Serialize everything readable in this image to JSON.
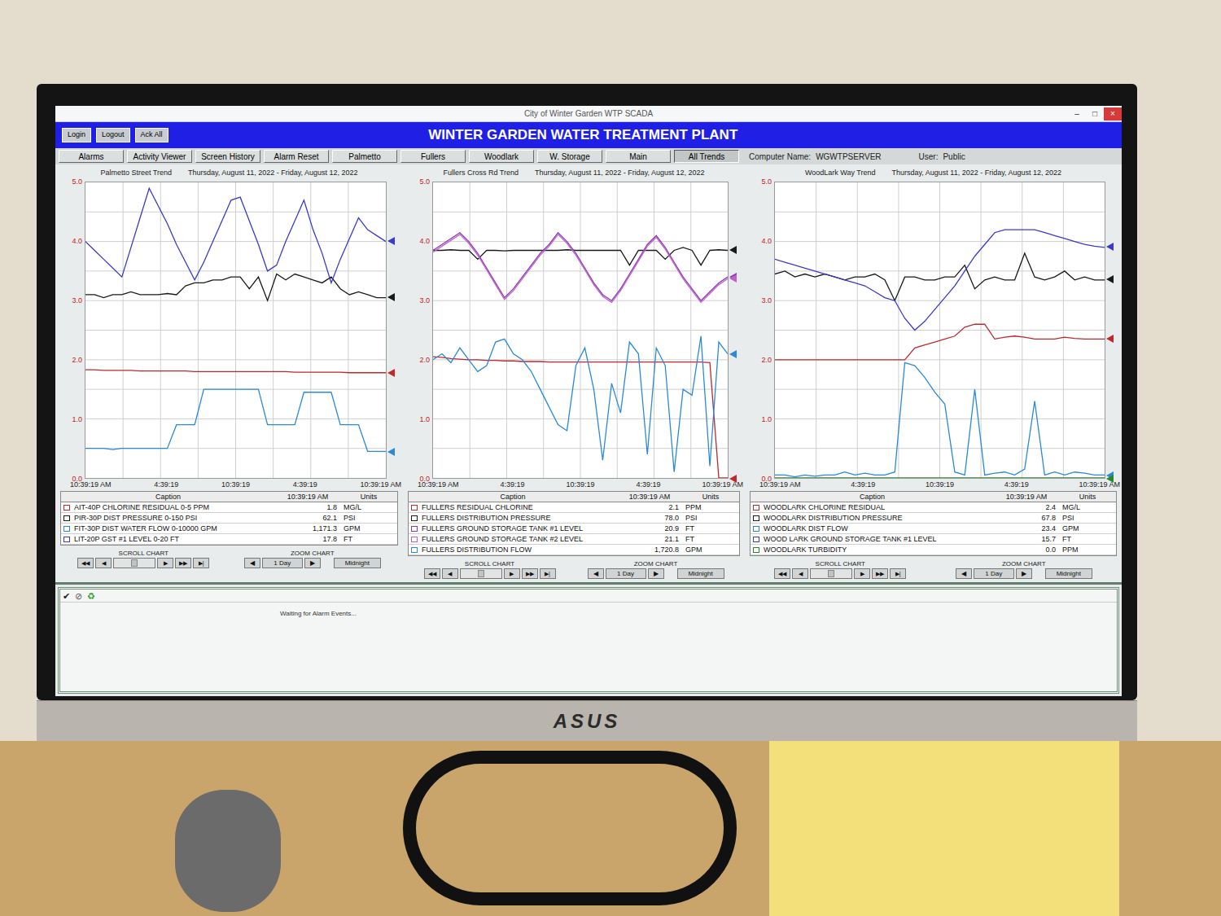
{
  "window": {
    "title": "City of Winter Garden WTP SCADA",
    "controls": [
      "–",
      "□",
      "×"
    ]
  },
  "header": {
    "buttons": [
      "Login",
      "Logout",
      "Ack All"
    ],
    "title": "WINTER GARDEN WATER TREATMENT PLANT"
  },
  "nav": {
    "buttons": [
      {
        "label": "Alarms",
        "selected": false
      },
      {
        "label": "Activity Viewer",
        "selected": false
      },
      {
        "label": "Screen History",
        "selected": false
      },
      {
        "label": "Alarm Reset",
        "selected": false
      },
      {
        "label": "Palmetto",
        "selected": false
      },
      {
        "label": "Fullers",
        "selected": false
      },
      {
        "label": "Woodlark",
        "selected": false
      },
      {
        "label": "W. Storage",
        "selected": false
      },
      {
        "label": "Main",
        "selected": false
      },
      {
        "label": "All Trends",
        "selected": true
      }
    ],
    "computer_label": "Computer Name:",
    "computer": "WGWTPSERVER",
    "user_label": "User:",
    "user": "Public"
  },
  "trends": [
    {
      "title": "Palmetto Street Trend",
      "dates": "Thursday, August 11, 2022 - Friday, August 12, 2022",
      "y_ticks": [
        "5.0",
        "4.0",
        "3.0",
        "2.0",
        "1.0",
        "0.0"
      ],
      "x_ticks": [
        "10:39:19 AM",
        "4:39:19",
        "10:39:19",
        "4:39:19",
        "10:39:19 AM"
      ],
      "legend_headers": [
        "Caption",
        "10:39:19 AM",
        "Units"
      ],
      "series": [
        {
          "caption": "AIT-40P CHLORINE RESIDUAL 0-5 PPM",
          "value": "1.8",
          "units": "MG/L",
          "color": "#c0282d",
          "values": [
            1.83,
            1.83,
            1.82,
            1.82,
            1.82,
            1.82,
            1.81,
            1.81,
            1.81,
            1.81,
            1.81,
            1.81,
            1.8,
            1.8,
            1.8,
            1.8,
            1.8,
            1.8,
            1.8,
            1.8,
            1.8,
            1.8,
            1.8,
            1.79,
            1.79,
            1.79,
            1.79,
            1.79,
            1.79,
            1.78,
            1.78,
            1.78,
            1.78,
            1.78
          ]
        },
        {
          "caption": "PIR-30P DIST PRESSURE 0-150 PSI",
          "value": "62.1",
          "units": "PSI",
          "color": "#1a1a1a",
          "values": [
            3.1,
            3.1,
            3.05,
            3.1,
            3.1,
            3.15,
            3.1,
            3.1,
            3.1,
            3.12,
            3.1,
            3.25,
            3.3,
            3.3,
            3.35,
            3.35,
            3.4,
            3.4,
            3.2,
            3.4,
            3.0,
            3.45,
            3.35,
            3.45,
            3.4,
            3.35,
            3.3,
            3.4,
            3.2,
            3.1,
            3.15,
            3.1,
            3.05,
            3.05
          ]
        },
        {
          "caption": "FIT-30P DIST WATER FLOW 0-10000 GPM",
          "value": "1,171.3",
          "units": "GPM",
          "color": "#2a8ad8",
          "values": [
            0.5,
            0.5,
            0.5,
            0.48,
            0.5,
            0.5,
            0.5,
            0.5,
            0.5,
            0.5,
            0.9,
            0.9,
            0.9,
            1.5,
            1.5,
            1.5,
            1.5,
            1.5,
            1.5,
            1.5,
            0.9,
            0.9,
            0.9,
            0.9,
            1.45,
            1.45,
            1.45,
            1.45,
            0.9,
            0.9,
            0.9,
            0.45,
            0.45,
            0.45
          ]
        },
        {
          "caption": "LIT-20P GST #1 LEVEL 0-20 FT",
          "value": "17.8",
          "units": "FT",
          "color": "#3a3acc",
          "values": [
            4.0,
            3.85,
            3.7,
            3.55,
            3.4,
            3.9,
            4.4,
            4.9,
            4.6,
            4.3,
            3.95,
            3.65,
            3.35,
            3.65,
            4.0,
            4.35,
            4.7,
            4.75,
            4.35,
            3.95,
            3.5,
            3.6,
            4.0,
            4.35,
            4.7,
            4.2,
            3.8,
            3.3,
            3.7,
            4.05,
            4.4,
            4.2,
            4.1,
            4.0
          ]
        }
      ],
      "scroll_label": "SCROLL CHART",
      "scroll_buttons": [
        "◀◀",
        "◀",
        "▶",
        "▶▶",
        "▶|"
      ],
      "zoom_label": "ZOOM CHART",
      "zoom_buttons": [
        "◀",
        "1 Day",
        "▶"
      ],
      "midnight": "Midnight"
    },
    {
      "title": "Fullers Cross Rd Trend",
      "dates": "Thursday, August 11, 2022 - Friday, August 12, 2022",
      "y_ticks": [
        "5.0",
        "4.0",
        "3.0",
        "2.0",
        "1.0",
        "0.0"
      ],
      "x_ticks": [
        "10:39:19 AM",
        "4:39:19",
        "10:39:19",
        "4:39:19",
        "10:39:19 AM"
      ],
      "legend_headers": [
        "Caption",
        "10:39:19 AM",
        "Units"
      ],
      "series": [
        {
          "caption": "FULLERS RESIDUAL CHLORINE",
          "value": "2.1",
          "units": "PPM",
          "color": "#c0282d",
          "values": [
            2.05,
            2.04,
            2.02,
            2.01,
            2.0,
            2.0,
            1.99,
            1.99,
            1.98,
            1.98,
            1.97,
            1.97,
            1.97,
            1.96,
            1.96,
            1.96,
            1.96,
            1.96,
            1.96,
            1.96,
            1.96,
            1.96,
            1.96,
            1.96,
            1.96,
            1.96,
            1.96,
            1.96,
            1.96,
            1.96,
            1.96,
            1.95,
            0.0,
            0.0
          ]
        },
        {
          "caption": "FULLERS DISTRIBUTION PRESSURE",
          "value": "78.0",
          "units": "PSI",
          "color": "#1a1a1a",
          "values": [
            3.85,
            3.85,
            3.86,
            3.85,
            3.85,
            3.7,
            3.85,
            3.85,
            3.84,
            3.85,
            3.85,
            3.85,
            3.85,
            3.85,
            3.85,
            3.86,
            3.85,
            3.85,
            3.85,
            3.85,
            3.85,
            3.85,
            3.6,
            3.85,
            3.85,
            3.85,
            3.7,
            3.85,
            3.9,
            3.85,
            3.6,
            3.85,
            3.86,
            3.85
          ]
        },
        {
          "caption": "FULLERS GROUND STORAGE TANK #1 LEVEL",
          "value": "20.9",
          "units": "FT",
          "color": "#8a3ab8",
          "values": [
            3.85,
            3.95,
            4.05,
            4.15,
            4.0,
            3.8,
            3.55,
            3.3,
            3.05,
            3.2,
            3.4,
            3.6,
            3.8,
            3.95,
            4.15,
            4.0,
            3.8,
            3.55,
            3.3,
            3.1,
            3.0,
            3.2,
            3.45,
            3.7,
            3.95,
            4.1,
            3.9,
            3.65,
            3.4,
            3.2,
            3.0,
            3.15,
            3.3,
            3.4
          ]
        },
        {
          "caption": "FULLERS GROUND STORAGE TANK #2 LEVEL",
          "value": "21.1",
          "units": "FT",
          "color": "#c060c8",
          "values": [
            3.82,
            3.92,
            4.02,
            4.12,
            3.97,
            3.77,
            3.52,
            3.27,
            3.02,
            3.17,
            3.37,
            3.57,
            3.77,
            3.92,
            4.12,
            3.97,
            3.77,
            3.52,
            3.27,
            3.07,
            2.97,
            3.17,
            3.42,
            3.67,
            3.92,
            4.07,
            3.87,
            3.62,
            3.37,
            3.17,
            2.97,
            3.12,
            3.27,
            3.37
          ]
        },
        {
          "caption": "FULLERS DISTRIBUTION FLOW",
          "value": "1,720.8",
          "units": "GPM",
          "color": "#2a8ad8",
          "values": [
            2.0,
            2.1,
            1.95,
            2.2,
            2.0,
            1.8,
            1.9,
            2.3,
            2.35,
            2.1,
            2.0,
            1.8,
            1.5,
            1.2,
            0.9,
            0.8,
            1.9,
            2.2,
            1.5,
            0.3,
            1.6,
            1.1,
            2.3,
            2.1,
            0.4,
            2.2,
            1.9,
            0.1,
            1.5,
            1.4,
            2.4,
            0.2,
            2.3,
            2.1
          ]
        }
      ],
      "scroll_label": "SCROLL CHART",
      "scroll_buttons": [
        "◀◀",
        "◀",
        "▶",
        "▶▶",
        "▶|"
      ],
      "zoom_label": "ZOOM CHART",
      "zoom_buttons": [
        "◀",
        "1 Day",
        "▶"
      ],
      "midnight": "Midnight"
    },
    {
      "title": "WoodLark Way Trend",
      "dates": "Thursday, August 11, 2022 - Friday, August 12, 2022",
      "y_ticks": [
        "5.0",
        "4.0",
        "3.0",
        "2.0",
        "1.0",
        "0.0"
      ],
      "x_ticks": [
        "10:39:19 AM",
        "4:39:19",
        "10:39:19",
        "4:39:19",
        "10:39:19 AM"
      ],
      "legend_headers": [
        "Caption",
        "10:39:19 AM",
        "Units"
      ],
      "series": [
        {
          "caption": "WOODLARK CHLORINE RESIDUAL",
          "value": "2.4",
          "units": "MG/L",
          "color": "#c0282d",
          "values": [
            2.0,
            2.0,
            2.0,
            2.0,
            2.0,
            2.0,
            2.0,
            2.0,
            2.0,
            2.0,
            2.0,
            2.0,
            2.0,
            2.0,
            2.2,
            2.25,
            2.3,
            2.35,
            2.4,
            2.55,
            2.6,
            2.6,
            2.35,
            2.38,
            2.4,
            2.38,
            2.35,
            2.35,
            2.35,
            2.38,
            2.36,
            2.35,
            2.35,
            2.35
          ]
        },
        {
          "caption": "WOODLARK DISTRIBUTION PRESSURE",
          "value": "67.8",
          "units": "PSI",
          "color": "#1a1a1a",
          "values": [
            3.45,
            3.5,
            3.4,
            3.45,
            3.4,
            3.45,
            3.4,
            3.35,
            3.4,
            3.4,
            3.45,
            3.35,
            3.0,
            3.4,
            3.4,
            3.35,
            3.35,
            3.4,
            3.4,
            3.6,
            3.2,
            3.35,
            3.4,
            3.35,
            3.35,
            3.8,
            3.4,
            3.35,
            3.4,
            3.5,
            3.35,
            3.4,
            3.35,
            3.35
          ]
        },
        {
          "caption": "WOODLARK DIST FLOW",
          "value": "23.4",
          "units": "GPM",
          "color": "#2a8ad8",
          "values": [
            0.05,
            0.05,
            0.02,
            0.05,
            0.03,
            0.05,
            0.05,
            0.1,
            0.05,
            0.08,
            0.05,
            0.05,
            0.1,
            1.95,
            1.9,
            1.7,
            1.45,
            1.25,
            0.1,
            0.05,
            1.5,
            0.05,
            0.08,
            0.1,
            0.05,
            0.15,
            1.3,
            0.05,
            0.1,
            0.05,
            0.1,
            0.08,
            0.05,
            0.05
          ]
        },
        {
          "caption": "WOOD LARK GROUND STORAGE TANK #1 LEVEL",
          "value": "15.7",
          "units": "FT",
          "color": "#3a3acc",
          "values": [
            3.7,
            3.65,
            3.6,
            3.55,
            3.5,
            3.45,
            3.4,
            3.35,
            3.3,
            3.25,
            3.15,
            3.05,
            3.0,
            2.7,
            2.5,
            2.65,
            2.85,
            3.05,
            3.25,
            3.5,
            3.75,
            3.95,
            4.15,
            4.2,
            4.2,
            4.2,
            4.2,
            4.15,
            4.1,
            4.05,
            4.0,
            3.95,
            3.92,
            3.9
          ]
        },
        {
          "caption": "WOODLARK TURBIDITY",
          "value": "0.0",
          "units": "PPM",
          "color": "#2a8a2a",
          "values": [
            0.0,
            0.0,
            0.0,
            0.0,
            0.0,
            0.0,
            0.0,
            0.0,
            0.0,
            0.0,
            0.0,
            0.0,
            0.0,
            0.0,
            0.0,
            0.0,
            0.0,
            0.0,
            0.0,
            0.0,
            0.0,
            0.0,
            0.0,
            0.0,
            0.0,
            0.0,
            0.0,
            0.0,
            0.0,
            0.0,
            0.0,
            0.0,
            0.0,
            0.0
          ]
        }
      ],
      "scroll_label": "SCROLL CHART",
      "scroll_buttons": [
        "◀◀",
        "◀",
        "▶",
        "▶▶",
        "▶|"
      ],
      "zoom_label": "ZOOM CHART",
      "zoom_buttons": [
        "◀",
        "1 Day",
        "▶"
      ],
      "midnight": "Midnight"
    }
  ],
  "alarms": {
    "toolbar": [
      "✔",
      "⊘",
      "♻"
    ],
    "message": "Waiting for Alarm Events..."
  },
  "monitor": {
    "brand": "ASUS"
  }
}
